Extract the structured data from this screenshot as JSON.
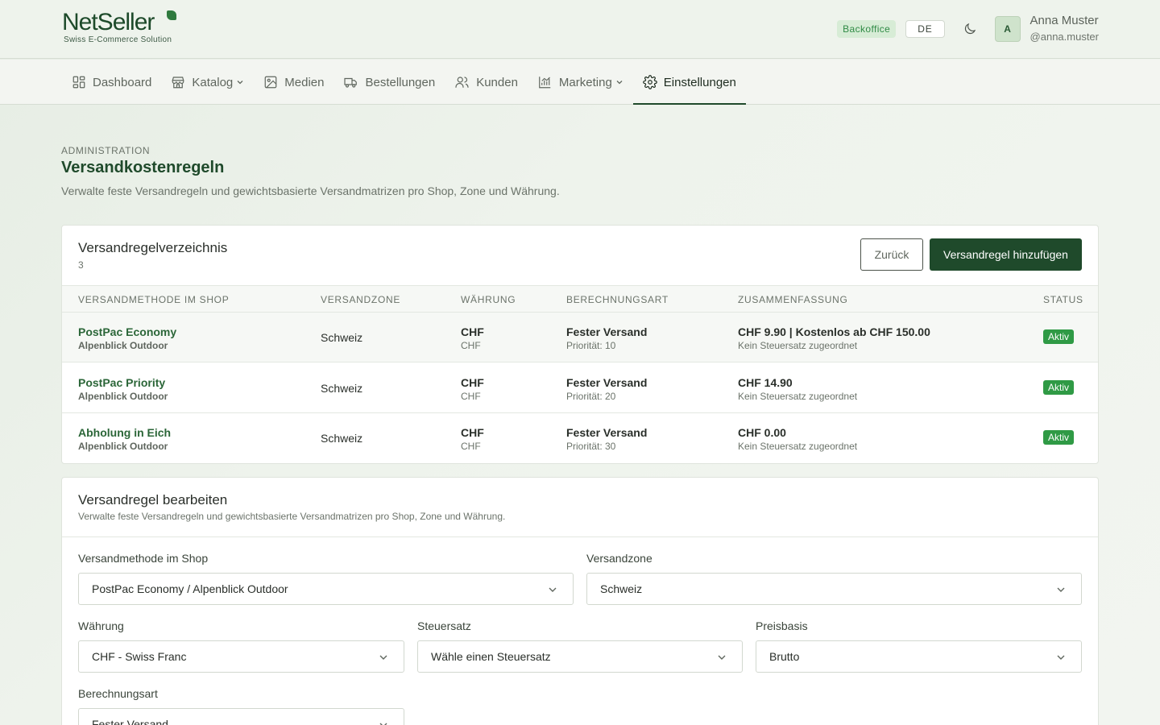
{
  "header": {
    "logo_text": "NetSeller",
    "logo_sub": "Swiss E-Commerce Solution",
    "badge": "Backoffice",
    "lang": "DE",
    "avatar_initial": "A",
    "user_name": "Anna Muster",
    "user_handle": "@anna.muster"
  },
  "nav": {
    "items": [
      {
        "label": "Dashboard",
        "icon": "dashboard-icon"
      },
      {
        "label": "Katalog",
        "icon": "store-icon",
        "dropdown": true
      },
      {
        "label": "Medien",
        "icon": "image-icon"
      },
      {
        "label": "Bestellungen",
        "icon": "truck-icon"
      },
      {
        "label": "Kunden",
        "icon": "users-icon"
      },
      {
        "label": "Marketing",
        "icon": "chart-icon",
        "dropdown": true
      },
      {
        "label": "Einstellungen",
        "icon": "gear-icon",
        "active": true
      }
    ]
  },
  "page": {
    "eyebrow": "ADMINISTRATION",
    "title": "Versandkostenregeln",
    "description": "Verwalte feste Versandregeln und gewichtsbasierte Versandmatrizen pro Shop, Zone und Währung."
  },
  "directory": {
    "title": "Versandregelverzeichnis",
    "count": "3",
    "back_label": "Zurück",
    "add_label": "Versandregel hinzufügen",
    "columns": [
      "VERSANDMETHODE IM SHOP",
      "VERSANDZONE",
      "WÄHRUNG",
      "BERECHNUNGSART",
      "ZUSAMMENFASSUNG",
      "STATUS"
    ],
    "rows": [
      {
        "method": "PostPac Economy",
        "shop": "Alpenblick Outdoor",
        "zone": "Schweiz",
        "currency": "CHF",
        "currency_sub": "CHF",
        "calc": "Fester Versand",
        "priority": "Priorität: 10",
        "summary": "CHF 9.90 | Kostenlos ab CHF 150.00",
        "summary_sub": "Kein Steuersatz zugeordnet",
        "status": "Aktiv"
      },
      {
        "method": "PostPac Priority",
        "shop": "Alpenblick Outdoor",
        "zone": "Schweiz",
        "currency": "CHF",
        "currency_sub": "CHF",
        "calc": "Fester Versand",
        "priority": "Priorität: 20",
        "summary": "CHF 14.90",
        "summary_sub": "Kein Steuersatz zugeordnet",
        "status": "Aktiv"
      },
      {
        "method": "Abholung in Eich",
        "shop": "Alpenblick Outdoor",
        "zone": "Schweiz",
        "currency": "CHF",
        "currency_sub": "CHF",
        "calc": "Fester Versand",
        "priority": "Priorität: 30",
        "summary": "CHF 0.00",
        "summary_sub": "Kein Steuersatz zugeordnet",
        "status": "Aktiv"
      }
    ]
  },
  "edit": {
    "title": "Versandregel bearbeiten",
    "description": "Verwalte feste Versandregeln und gewichtsbasierte Versandmatrizen pro Shop, Zone und Währung.",
    "fields": {
      "method_label": "Versandmethode im Shop",
      "method_value": "PostPac Economy / Alpenblick Outdoor",
      "zone_label": "Versandzone",
      "zone_value": "Schweiz",
      "currency_label": "Währung",
      "currency_value": "CHF - Swiss Franc",
      "tax_label": "Steuersatz",
      "tax_value": "Wähle einen Steuersatz",
      "basis_label": "Preisbasis",
      "basis_value": "Brutto",
      "calc_label": "Berechnungsart",
      "calc_value": "Fester Versand"
    }
  },
  "colors": {
    "primary": "#1f4a2b",
    "link_green": "#2b6638",
    "status_green": "#2f9a45",
    "badge_bg": "#d7ecd6"
  }
}
